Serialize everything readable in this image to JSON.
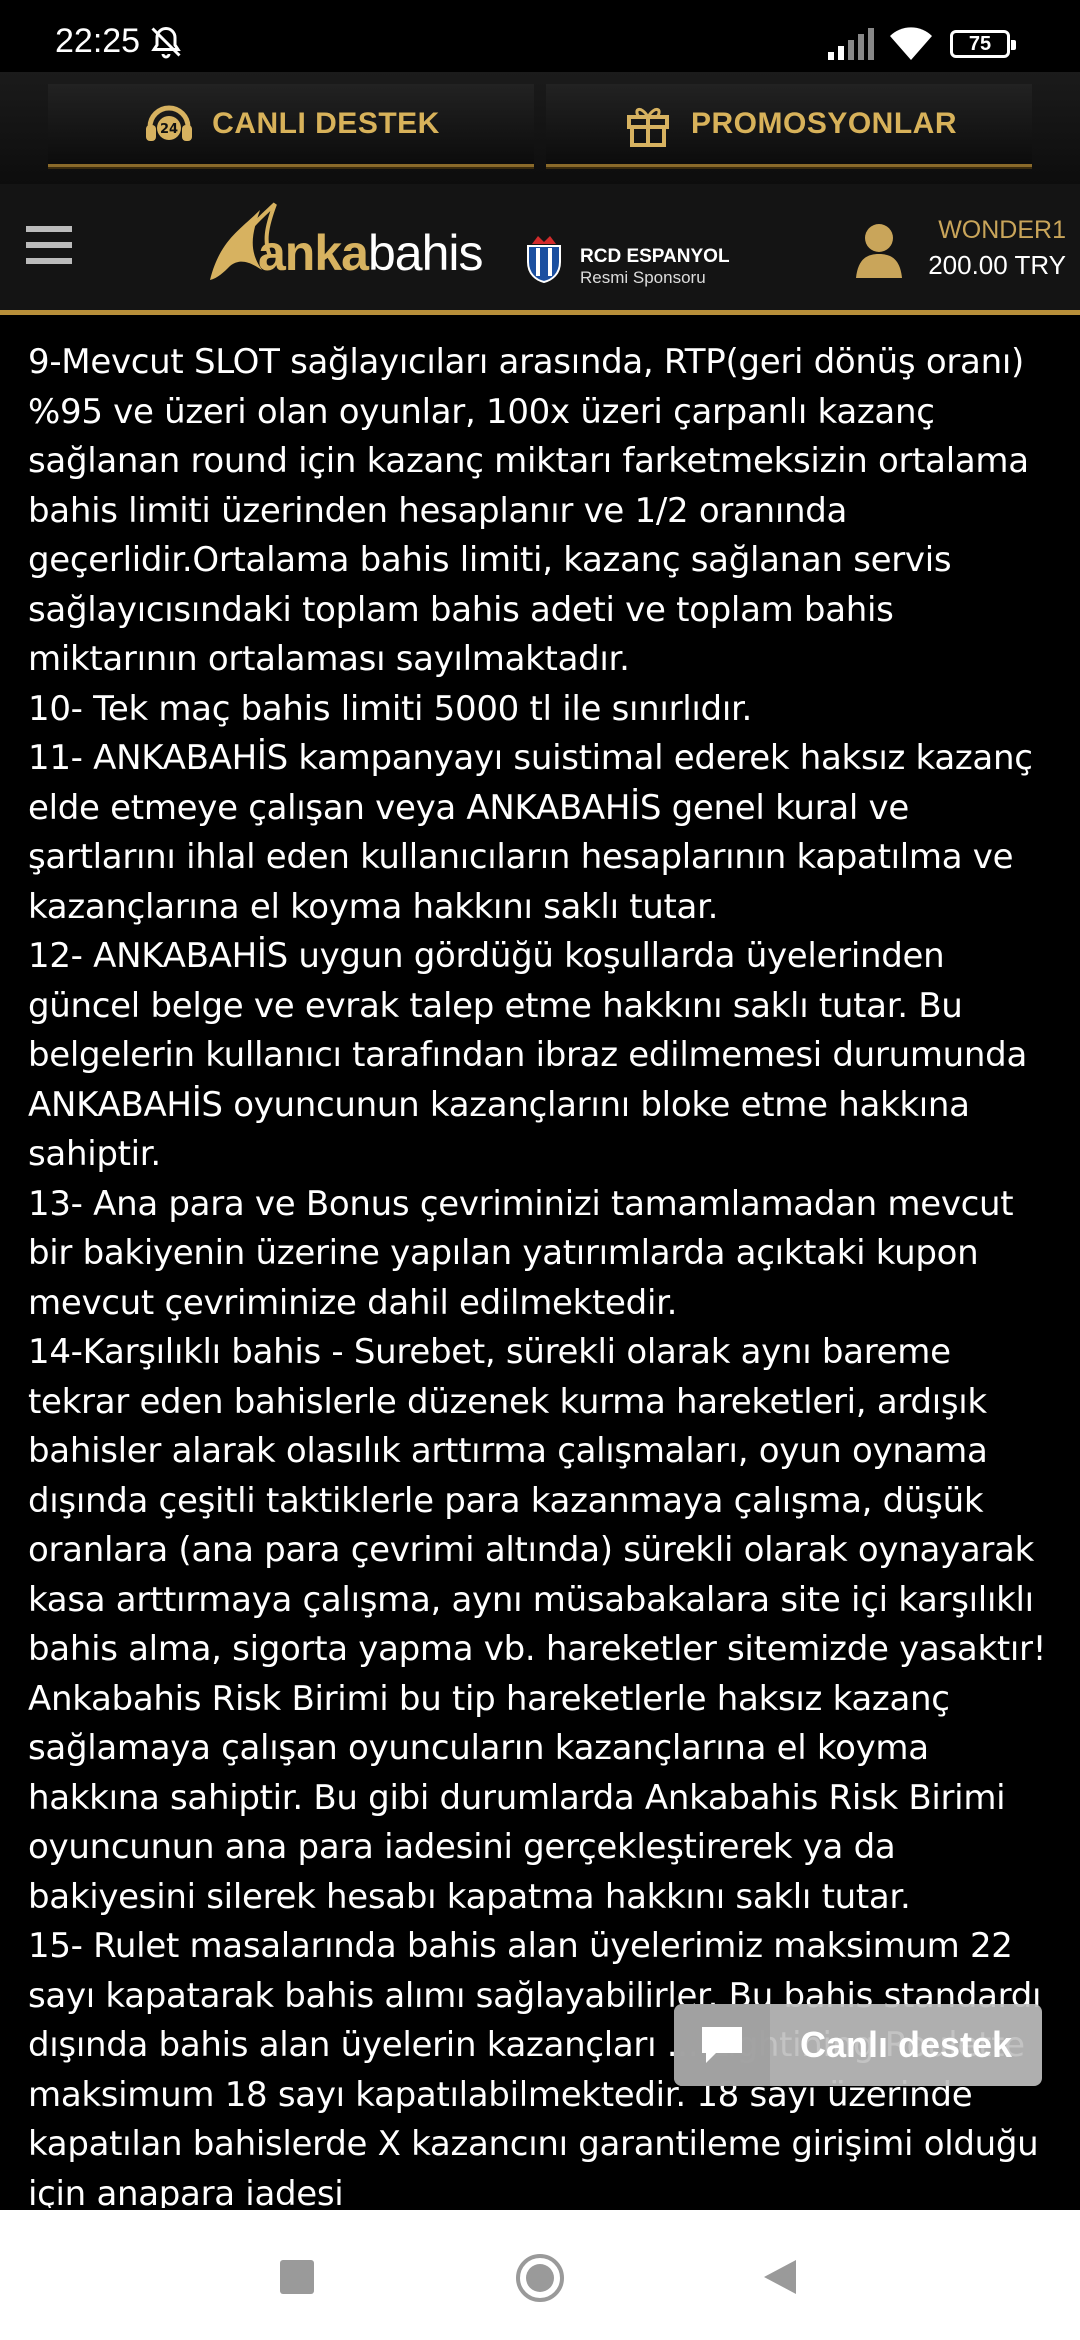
{
  "status_bar": {
    "time": "22:25",
    "battery": "75",
    "icons": [
      "bell-off-icon",
      "signal-icon",
      "wifi-icon",
      "battery-icon"
    ]
  },
  "promo_bar": {
    "support_label": "CANLI DESTEK",
    "support_badge": "24",
    "promotions_label": "PROMOSYONLAR"
  },
  "header": {
    "logo_part1": "anka",
    "logo_part2": "bahis",
    "sponsor_name": "RCD ESPANYOL",
    "sponsor_subtitle": "Resmi Sponsoru",
    "username": "WONDER1",
    "balance": "200.00 TRY"
  },
  "content": {
    "paragraphs": [
      "9-Mevcut SLOT sağlayıcıları arasında, RTP(geri dönüş oranı) %95 ve üzeri olan oyunlar, 100x üzeri çarpanlı kazanç sağlanan round için kazanç miktarı farketmeksizin ortalama bahis limiti üzerinden hesaplanır ve 1/2 oranında geçerlidir.Ortalama bahis limiti, kazanç sağlanan servis sağlayıcısındaki toplam bahis adeti ve toplam bahis miktarının ortalaması sayılmaktadır.",
      "10- Tek maç bahis limiti 5000 tl ile sınırlıdır.",
      "11- ANKABAHİS kampanyayı suistimal ederek haksız kazanç elde etmeye çalışan veya ANKABAHİS genel kural ve şartlarını ihlal eden kullanıcıların hesaplarının kapatılma ve kazançlarına el koyma hakkını saklı tutar.",
      "12- ANKABAHİS uygun gördüğü koşullarda üyelerinden güncel belge ve evrak talep etme hakkını saklı tutar. Bu belgelerin kullanıcı tarafından ibraz edilmemesi durumunda ANKABAHİS oyuncunun kazançlarını bloke etme hakkına sahiptir.",
      "13- Ana para ve Bonus çevriminizi tamamlamadan mevcut bir bakiyenin üzerine yapılan yatırımlarda açıktaki kupon mevcut çevriminize dahil edilmektedir.",
      "14-Karşılıklı bahis - Surebet, sürekli olarak aynı bareme tekrar eden bahislerle düzenek kurma hareketleri, ardışık bahisler alarak olasılık arttırma çalışmaları, oyun oynama dışında çeşitli taktiklerle para kazanmaya çalışma, düşük oranlara (ana para çevrimi altında) sürekli olarak oynayarak kasa arttırmaya çalışma, aynı müsabakalara site içi karşılıklı bahis alma, sigorta yapma vb. hareketler sitemizde yasaktır! Ankabahis Risk Birimi bu tip hareketlerle haksız kazanç sağlamaya çalışan oyuncuların kazançlarına el koyma hakkına sahiptir. Bu gibi durumlarda Ankabahis Risk Birimi oyuncunun ana para iadesini gerçekleştirerek ya da bakiyesini silerek hesabı kapatma hakkını saklı tutar.",
      "15- Rulet masalarında bahis alan üyelerimiz maksimum 22 sayı kapatarak bahis alımı sağlayabilirler. Bu bahis standardı dışında bahis alan üyelerin kazançları ... Lightining Roulette maksimum 18 sayı kapatılabilmektedir. 18 sayı üzerinde kapatılan bahislerde X kazancını garantileme girişimi olduğu için anapara iadesi"
    ]
  },
  "live_support": {
    "label": "Canlı destek"
  },
  "colors": {
    "gold": "#d7b260",
    "header_border": "#b88f3a",
    "background": "#000000"
  }
}
